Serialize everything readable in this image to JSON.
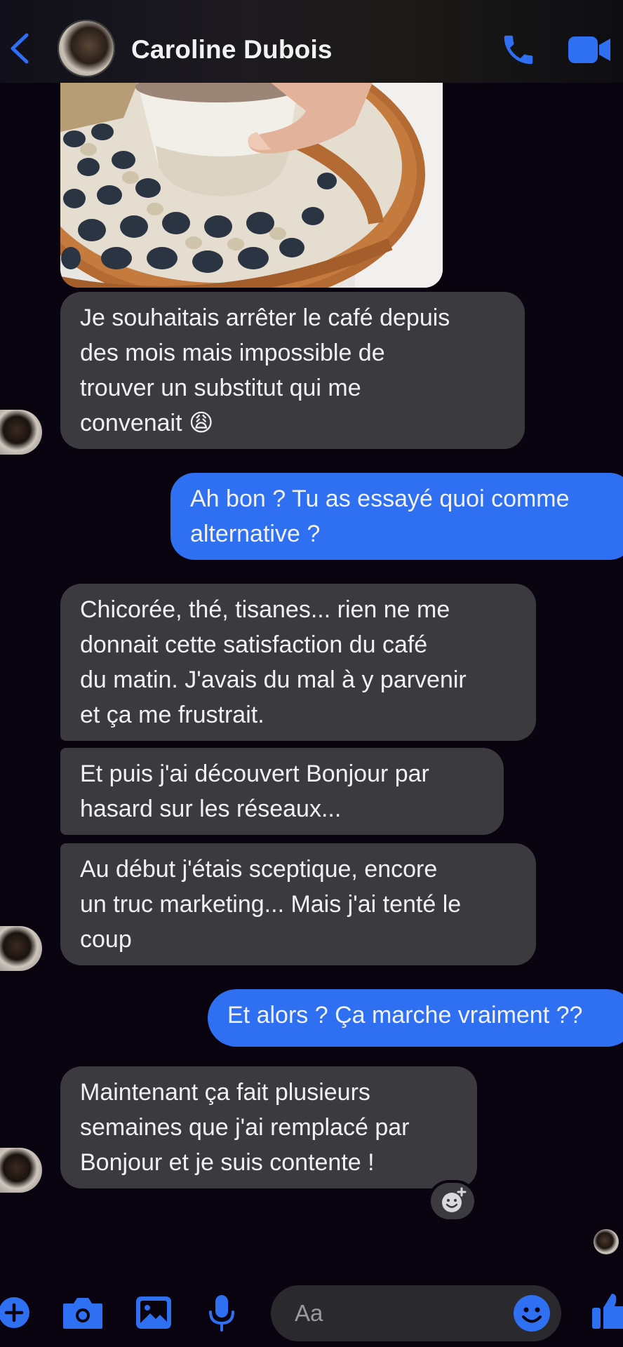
{
  "header": {
    "contact_name": "Caroline Dubois",
    "back_icon": "chevron-left-icon",
    "call_icon": "phone-icon",
    "video_icon": "video-camera-icon",
    "accent": "#2f6ff2"
  },
  "messages": [
    {
      "from": "contact",
      "type": "image",
      "description_icon": "photo-message"
    },
    {
      "from": "contact",
      "text": "Je souhaitais arrêter le café depuis\ndes mois mais impossible de\ntrouver un substitut qui me\nconvenait 😩"
    },
    {
      "from": "me",
      "text": "Ah bon ? Tu as essayé quoi comme\nalternative ?"
    },
    {
      "from": "contact",
      "text": "Chicorée, thé, tisanes... rien ne me\ndonnait cette satisfaction du café\ndu matin. J'avais du mal à y parvenir\net ça me frustrait."
    },
    {
      "from": "contact",
      "text": "Et puis j'ai découvert Bonjour par\nhasard sur les réseaux..."
    },
    {
      "from": "contact",
      "text": "Au début j'étais sceptique, encore\nun truc marketing... Mais j'ai tenté le\ncoup"
    },
    {
      "from": "me",
      "text": "Et alors ? Ça marche vraiment ??"
    },
    {
      "from": "contact",
      "text": "Maintenant ça fait plusieurs\nsemaines que j'ai remplacé par\nBonjour et je suis contente !"
    }
  ],
  "reaction_icon": "add-reaction-icon",
  "composer": {
    "placeholder": "Aa",
    "icons": [
      "plus-icon",
      "camera-icon",
      "gallery-icon",
      "microphone-icon",
      "emoji-icon",
      "thumbs-up-icon"
    ]
  },
  "colors": {
    "background": "#0a0310",
    "incoming_bubble": "#3b3a3f",
    "outgoing_bubble": "#2f6ff2",
    "icon_blue": "#2f6ff2"
  }
}
